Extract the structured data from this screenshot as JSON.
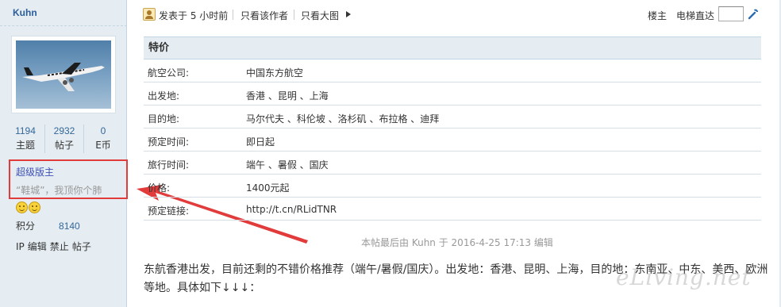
{
  "user": {
    "name": "Kuhn",
    "stats": [
      {
        "value": "1194",
        "label": "主题"
      },
      {
        "value": "2932",
        "label": "帖子"
      },
      {
        "value": "0",
        "label": "E币"
      }
    ],
    "rank": "超级版主",
    "custom_title": "“鞋城”，我顶你个肺",
    "points_label": "积分",
    "points_value": "8140",
    "admin_links": [
      "IP",
      "编辑",
      "禁止",
      "帖子"
    ]
  },
  "topbar": {
    "posted": "发表于 5 小时前",
    "only_author": "只看该作者",
    "only_big_image": "只看大图",
    "floor_label": "楼主",
    "elevator_label": "电梯直达",
    "elevator_input": ""
  },
  "info_table": {
    "title": "特价",
    "rows": [
      {
        "key": "航空公司:",
        "value": "中国东方航空"
      },
      {
        "key": "出发地:",
        "value": "香港 、昆明 、上海"
      },
      {
        "key": "目的地:",
        "value": "马尔代夫 、科伦坡 、洛杉矶 、布拉格 、迪拜"
      },
      {
        "key": "预定时间:",
        "value": "即日起"
      },
      {
        "key": "旅行时间:",
        "value": "端午 、暑假 、国庆"
      },
      {
        "key": "价格:",
        "value": "1400元起"
      },
      {
        "key": "预定链接:",
        "value": "http://t.cn/RLidTNR"
      }
    ]
  },
  "edit_note": {
    "prefix": "本帖最后由 ",
    "user": "Kuhn",
    "suffix": " 于 2016-4-25 17:13 编辑"
  },
  "body": "东航香港出发，目前还剩的不错价格推荐（端午/暑假/国庆）。出发地：香港、昆明、上海，目的地：东南亚、中东、美西、欧洲等地。具体如下↓↓↓：",
  "watermark": "eLiving.net",
  "colors": {
    "sidebar_bg": "#e5edf2",
    "border": "#c2d5e3",
    "link": "#2b5d9b",
    "highlight": "#e23b3b"
  },
  "icons": [
    "poster-avatar-icon",
    "triangle-right-icon",
    "jump-arrow-icon",
    "smiley-medal-icon",
    "annotation-arrow"
  ]
}
